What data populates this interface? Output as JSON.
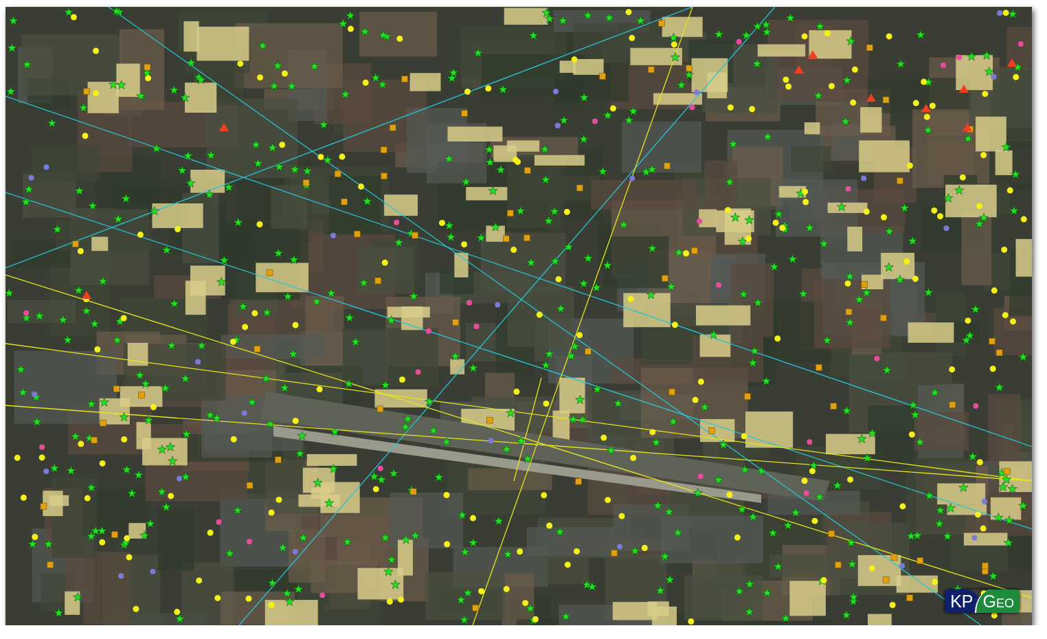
{
  "logo": {
    "left_text": "KP",
    "right_text": "Geo"
  }
}
